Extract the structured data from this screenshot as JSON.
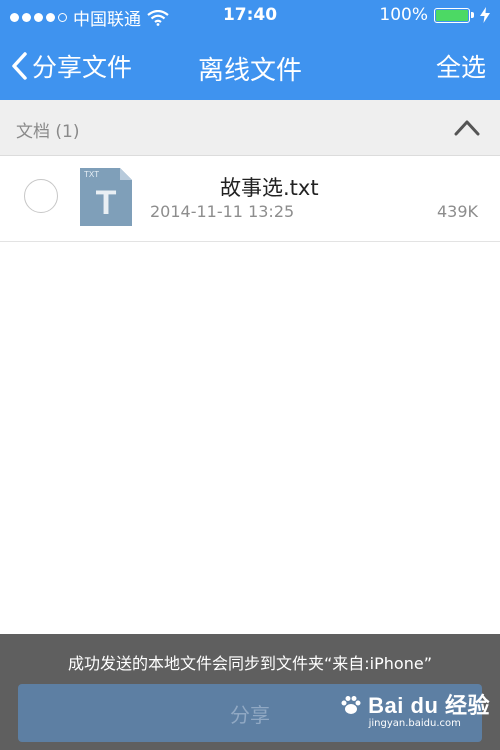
{
  "status_bar": {
    "carrier": "中国联通",
    "time": "17:40",
    "battery": "100%",
    "battery_level": 1.0,
    "signal_bars": 4,
    "signal_total": 5
  },
  "nav": {
    "back_label": "分享文件",
    "title": "离线文件",
    "select_all_label": "全选"
  },
  "section": {
    "title": "文档 (1)"
  },
  "files": [
    {
      "icon_label": "TXT",
      "icon_letter": "T",
      "name": "故事选.txt",
      "date": "2014-11-11 13:25",
      "size": "439K"
    }
  ],
  "bottom": {
    "note": "成功发送的本地文件会同步到文件夹“来自:iPhone”",
    "share_label": "分享"
  },
  "watermark": {
    "main": "Bai du 经验",
    "sub": "jingyan.baidu.com"
  },
  "colors": {
    "nav_blue": "#3f93ef",
    "battery_green": "#4cd964",
    "share_button": "#5d7fa3"
  },
  "icons": [
    "wifi-icon",
    "battery-icon",
    "charging-bolt-icon",
    "back-chevron-icon",
    "chevron-up-icon",
    "txt-file-icon",
    "paw-icon"
  ]
}
